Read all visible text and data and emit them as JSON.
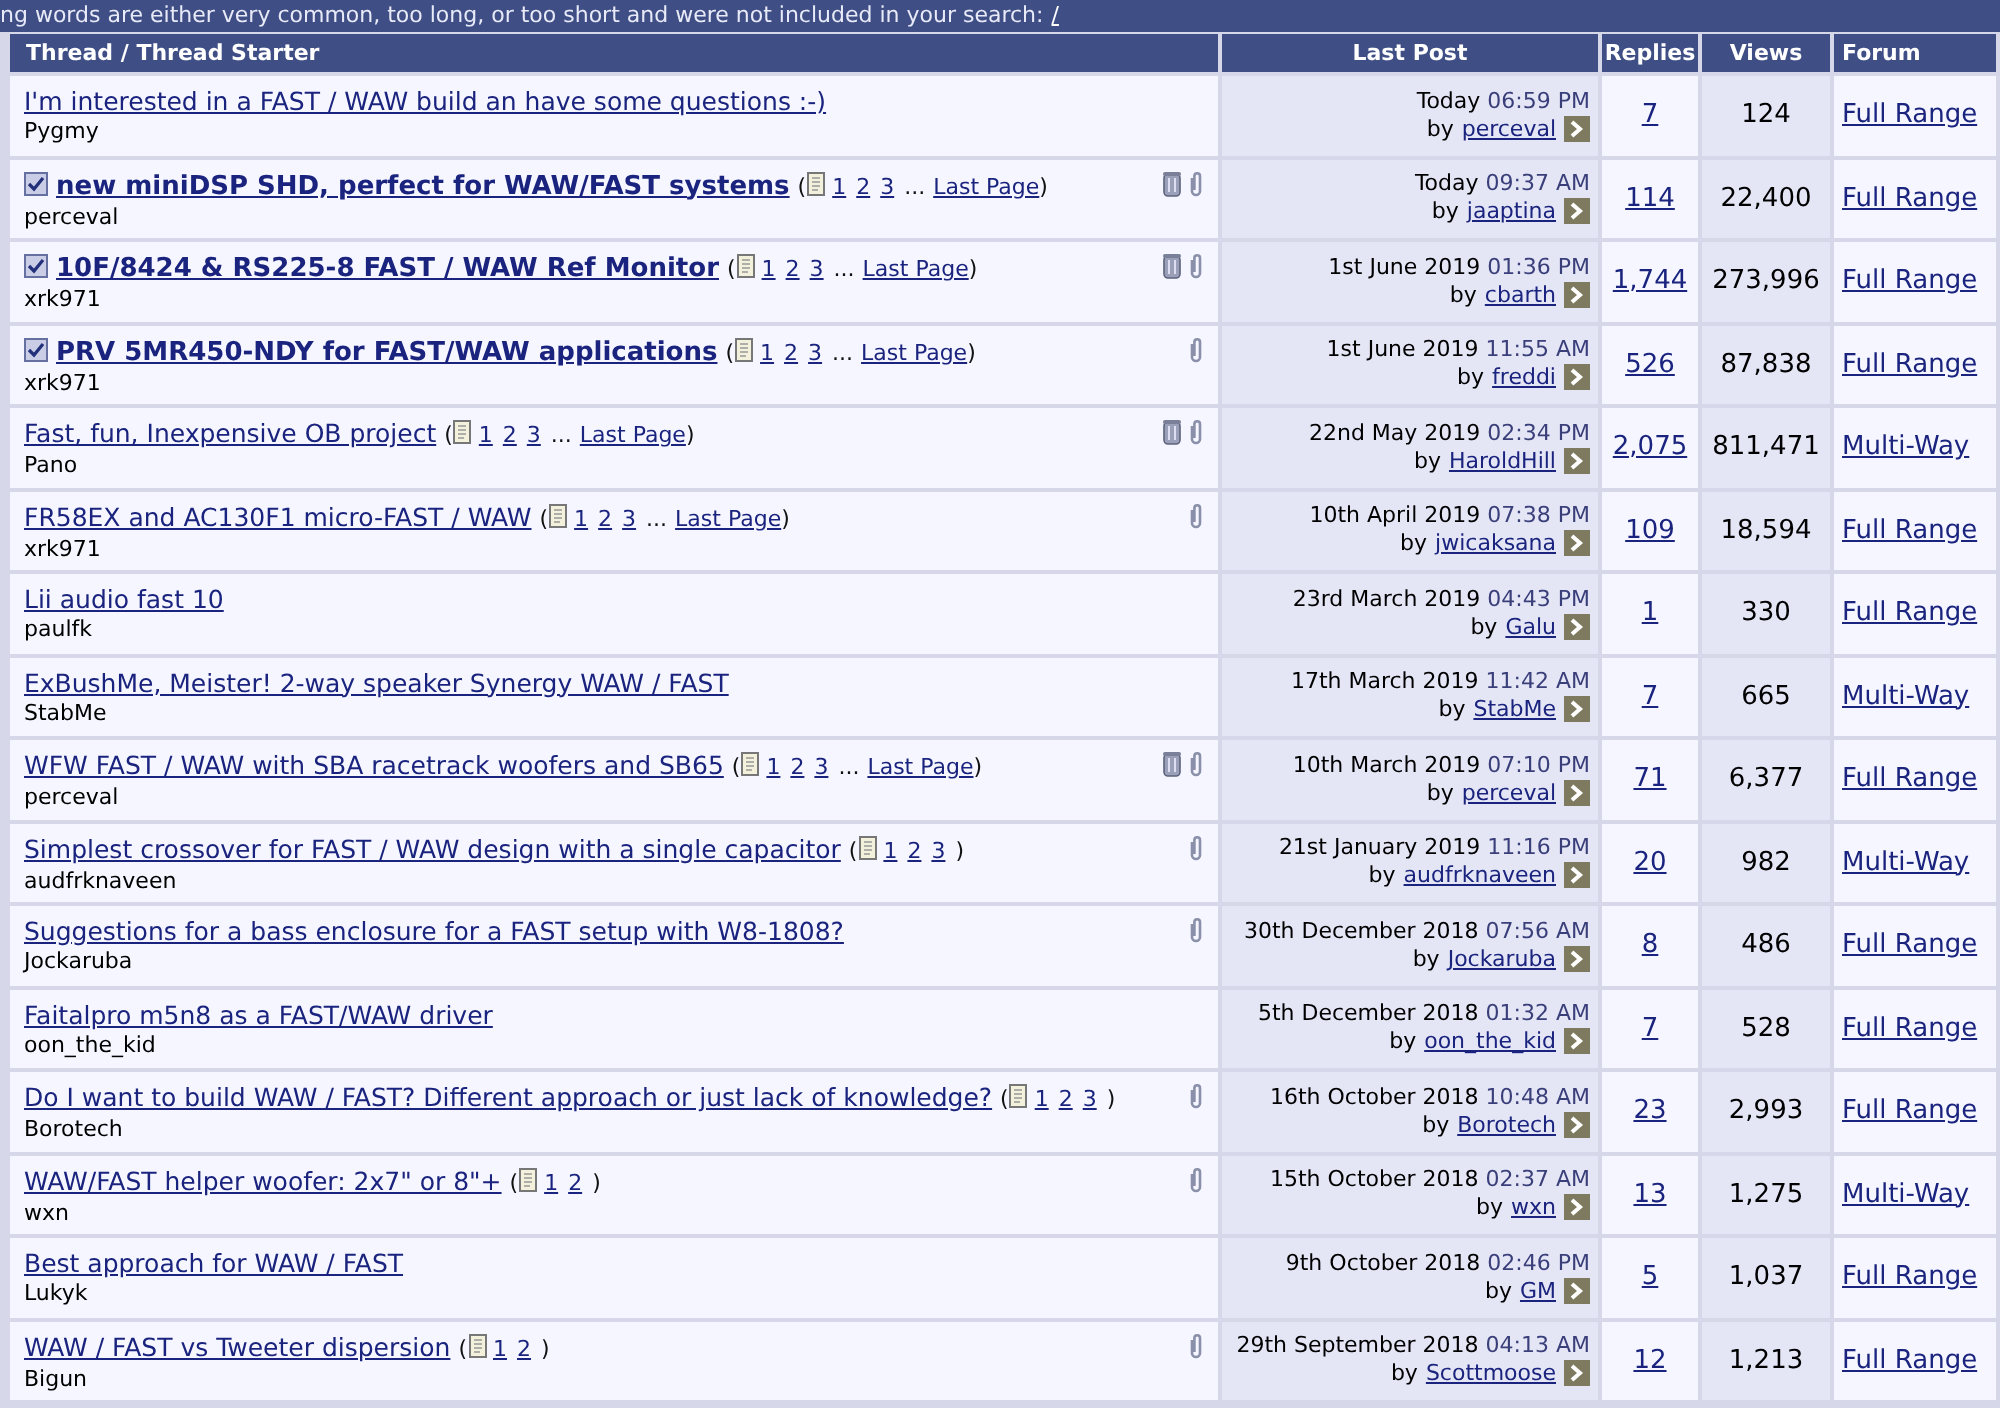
{
  "notice": {
    "text": "ng words are either very common, too long, or too short and were not included in your search:",
    "link": "/"
  },
  "columns": [
    "Thread / Thread Starter",
    "Last Post",
    "Replies",
    "Views",
    "Forum"
  ],
  "threads": [
    {
      "title": "I'm interested in a FAST / WAW build an have some questions :-)",
      "sticky": false,
      "starter": "Pygmy",
      "bin": false,
      "attachment": false,
      "date": "Today",
      "time": "06:59 PM",
      "by": "by",
      "user": "perceval",
      "replies": "7",
      "views": "124",
      "forum": "Full Range"
    },
    {
      "title": "new miniDSP SHD, perfect for WAW/FAST systems",
      "sticky": true,
      "pages": {
        "open": "(",
        "links": [
          "1",
          "2",
          "3"
        ],
        "more": "...",
        "last": "Last Page",
        "close": ")"
      },
      "starter": "perceval",
      "bin": true,
      "attachment": true,
      "date": "Today",
      "time": "09:37 AM",
      "by": "by",
      "user": "jaaptina",
      "replies": "114",
      "views": "22,400",
      "forum": "Full Range"
    },
    {
      "title": "10F/8424 & RS225-8 FAST / WAW Ref Monitor",
      "sticky": true,
      "pages": {
        "open": "(",
        "links": [
          "1",
          "2",
          "3"
        ],
        "more": "...",
        "last": "Last Page",
        "close": ")"
      },
      "starter": "xrk971",
      "bin": true,
      "attachment": true,
      "date": "1st June 2019",
      "time": "01:36 PM",
      "by": "by",
      "user": "cbarth",
      "replies": "1,744",
      "views": "273,996",
      "forum": "Full Range"
    },
    {
      "title": "PRV 5MR450-NDY for FAST/WAW applications",
      "sticky": true,
      "pages": {
        "open": "(",
        "links": [
          "1",
          "2",
          "3"
        ],
        "more": "...",
        "last": "Last Page",
        "close": ")"
      },
      "starter": "xrk971",
      "bin": false,
      "attachment": true,
      "date": "1st June 2019",
      "time": "11:55 AM",
      "by": "by",
      "user": "freddi",
      "replies": "526",
      "views": "87,838",
      "forum": "Full Range"
    },
    {
      "title": "Fast, fun, Inexpensive OB project",
      "sticky": false,
      "pages": {
        "open": "(",
        "links": [
          "1",
          "2",
          "3"
        ],
        "more": "...",
        "last": "Last Page",
        "close": ")"
      },
      "starter": "Pano",
      "bin": true,
      "attachment": true,
      "date": "22nd May 2019",
      "time": "02:34 PM",
      "by": "by",
      "user": "HaroldHill",
      "replies": "2,075",
      "views": "811,471",
      "forum": "Multi-Way"
    },
    {
      "title": "FR58EX and AC130F1 micro-FAST / WAW",
      "sticky": false,
      "pages": {
        "open": "(",
        "links": [
          "1",
          "2",
          "3"
        ],
        "more": "...",
        "last": "Last Page",
        "close": ")"
      },
      "starter": "xrk971",
      "bin": false,
      "attachment": true,
      "date": "10th April 2019",
      "time": "07:38 PM",
      "by": "by",
      "user": "jwicaksana",
      "replies": "109",
      "views": "18,594",
      "forum": "Full Range"
    },
    {
      "title": "Lii audio fast 10",
      "sticky": false,
      "starter": "paulfk",
      "bin": false,
      "attachment": false,
      "date": "23rd March 2019",
      "time": "04:43 PM",
      "by": "by",
      "user": "Galu",
      "replies": "1",
      "views": "330",
      "forum": "Full Range"
    },
    {
      "title": "ExBushMe, Meister! 2-way speaker Synergy WAW / FAST",
      "sticky": false,
      "starter": "StabMe",
      "bin": false,
      "attachment": false,
      "date": "17th March 2019",
      "time": "11:42 AM",
      "by": "by",
      "user": "StabMe",
      "replies": "7",
      "views": "665",
      "forum": "Multi-Way"
    },
    {
      "title": "WFW FAST / WAW with SBA racetrack woofers and SB65",
      "sticky": false,
      "pages": {
        "open": "(",
        "links": [
          "1",
          "2",
          "3"
        ],
        "more": "...",
        "last": "Last Page",
        "close": ")"
      },
      "starter": "perceval",
      "bin": true,
      "attachment": true,
      "date": "10th March 2019",
      "time": "07:10 PM",
      "by": "by",
      "user": "perceval",
      "replies": "71",
      "views": "6,377",
      "forum": "Full Range"
    },
    {
      "title": "Simplest crossover for FAST / WAW design with a single capacitor",
      "sticky": false,
      "pages": {
        "open": "(",
        "links": [
          "1",
          "2",
          "3"
        ],
        "close": ")"
      },
      "starter": "audfrknaveen",
      "bin": false,
      "attachment": true,
      "date": "21st January 2019",
      "time": "11:16 PM",
      "by": "by",
      "user": "audfrknaveen",
      "replies": "20",
      "views": "982",
      "forum": "Multi-Way"
    },
    {
      "title": "Suggestions for a bass enclosure for a FAST setup with W8-1808?",
      "sticky": false,
      "starter": "Jockaruba",
      "bin": false,
      "attachment": true,
      "date": "30th December 2018",
      "time": "07:56 AM",
      "by": "by",
      "user": "Jockaruba",
      "replies": "8",
      "views": "486",
      "forum": "Full Range"
    },
    {
      "title": "Faitalpro m5n8 as a FAST/WAW driver",
      "sticky": false,
      "starter": "oon_the_kid",
      "bin": false,
      "attachment": false,
      "date": "5th December 2018",
      "time": "01:32 AM",
      "by": "by",
      "user": "oon_the_kid",
      "replies": "7",
      "views": "528",
      "forum": "Full Range"
    },
    {
      "title": "Do I want to build WAW / FAST? Different approach or just lack of knowledge?",
      "sticky": false,
      "pages": {
        "open": "(",
        "links": [
          "1",
          "2",
          "3"
        ],
        "close": ")"
      },
      "starter": "Borotech",
      "bin": false,
      "attachment": true,
      "date": "16th October 2018",
      "time": "10:48 AM",
      "by": "by",
      "user": "Borotech",
      "replies": "23",
      "views": "2,993",
      "forum": "Full Range"
    },
    {
      "title": "WAW/FAST helper woofer: 2x7\" or 8\"+",
      "sticky": false,
      "pages": {
        "open": "(",
        "links": [
          "1",
          "2"
        ],
        "close": ")"
      },
      "starter": "wxn",
      "bin": false,
      "attachment": true,
      "date": "15th October 2018",
      "time": "02:37 AM",
      "by": "by",
      "user": "wxn",
      "replies": "13",
      "views": "1,275",
      "forum": "Multi-Way"
    },
    {
      "title": "Best approach for WAW / FAST",
      "sticky": false,
      "starter": "Lukyk",
      "bin": false,
      "attachment": false,
      "date": "9th October 2018",
      "time": "02:46 PM",
      "by": "by",
      "user": "GM",
      "replies": "5",
      "views": "1,037",
      "forum": "Full Range"
    },
    {
      "title": "WAW / FAST vs Tweeter dispersion",
      "sticky": false,
      "pages": {
        "open": "(",
        "links": [
          "1",
          "2"
        ],
        "close": ")"
      },
      "starter": "Bigun",
      "bin": false,
      "attachment": true,
      "date": "29th September 2018",
      "time": "04:13 AM",
      "by": "by",
      "user": "Scottmoose",
      "replies": "12",
      "views": "1,213",
      "forum": "Full Range"
    }
  ]
}
